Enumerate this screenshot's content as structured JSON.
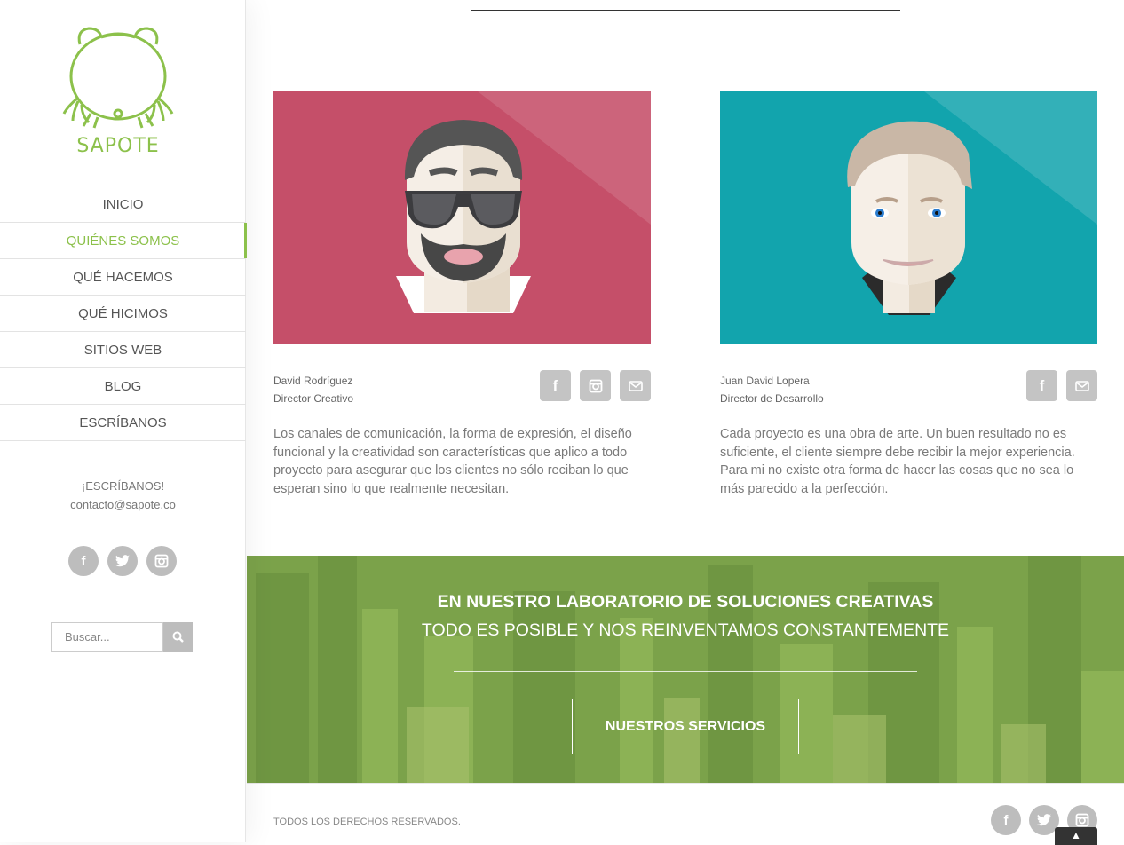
{
  "brand": {
    "name": "SAPOTE",
    "accent": "#8cc14b"
  },
  "nav": {
    "items": [
      {
        "label": "INICIO",
        "active": false
      },
      {
        "label": "QUIÉNES SOMOS",
        "active": true
      },
      {
        "label": "QUÉ HACEMOS",
        "active": false
      },
      {
        "label": "QUÉ HICIMOS",
        "active": false
      },
      {
        "label": "SITIOS WEB",
        "active": false
      },
      {
        "label": "BLOG",
        "active": false
      },
      {
        "label": "ESCRÍBANOS",
        "active": false
      }
    ]
  },
  "contact": {
    "heading": "¡ESCRÍBANOS!",
    "email": "contacto@sapote.co"
  },
  "sidebar_social": [
    "facebook-icon",
    "twitter-icon",
    "instagram-icon"
  ],
  "search": {
    "placeholder": "Buscar..."
  },
  "team": [
    {
      "name": "David Rodríguez",
      "role": "Director Creativo",
      "bio": "Los canales de comunicación, la forma de expresión, el diseño funcional y la creatividad son características que aplico a todo proyecto para asegurar que los clientes no sólo reciban lo que esperan sino lo que realmente necesitan.",
      "bg_color": "#c54f69",
      "social": [
        "facebook-icon",
        "instagram-icon",
        "email-icon"
      ]
    },
    {
      "name": "Juan David Lopera",
      "role": "Director de Desarrollo",
      "bio": "Cada proyecto es una obra de arte. Un buen resultado no es suficiente, el cliente siempre debe recibir la mejor experiencia. Para mi no existe otra forma de hacer las cosas que no sea lo más parecido a la perfección.",
      "bg_color": "#12a4ad",
      "social": [
        "facebook-icon",
        "email-icon"
      ]
    }
  ],
  "banner": {
    "title": "EN NUESTRO LABORATORIO DE SOLUCIONES CREATIVAS",
    "subtitle": "TODO ES POSIBLE Y NOS REINVENTAMOS CONSTANTEMENTE",
    "button": "NUESTROS SERVICIOS",
    "color": "#7ba24a"
  },
  "footer": {
    "copyright": "TODOS LOS DERECHOS RESERVADOS.",
    "social": [
      "facebook-icon",
      "twitter-icon",
      "instagram-icon"
    ]
  }
}
